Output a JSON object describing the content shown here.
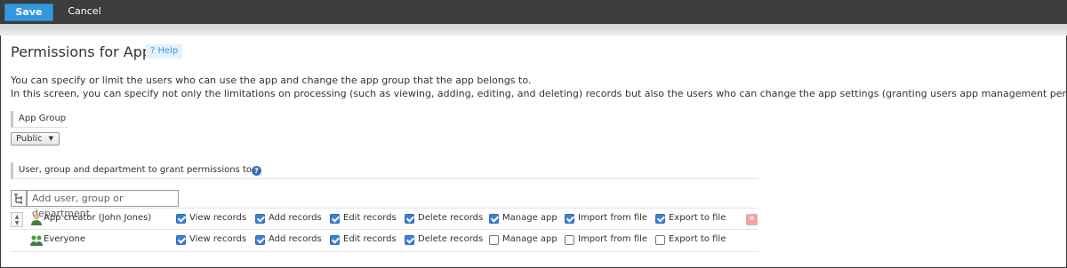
{
  "toolbar": {
    "save_label": "Save",
    "cancel_label": "Cancel"
  },
  "page": {
    "title": "Permissions for App",
    "help_label": "Help",
    "help_icon": "?",
    "description_line1": "You can specify or limit the users who can use the app and change the app group that the app belongs to.",
    "description_line2": "In this screen, you can specify not only the limitations on processing (such as viewing, adding, editing, and deleting) records but also the users who can change the app settings (granting users app management permissions)."
  },
  "app_group": {
    "label": "App Group",
    "selected": "Public"
  },
  "permissions_section": {
    "label": "User, group and department to grant permissions to",
    "add_placeholder": "Add user, group or department"
  },
  "permission_columns": [
    "View records",
    "Add records",
    "Edit records",
    "Delete records",
    "Manage app",
    "Import from file",
    "Export to file"
  ],
  "rows": [
    {
      "name": "App creator (John Jones)",
      "icon": "user-icon",
      "view": true,
      "add": true,
      "edit": true,
      "delete": true,
      "manage": true,
      "import": true,
      "export": true
    },
    {
      "name": "Everyone",
      "icon": "group-icon",
      "view": true,
      "add": true,
      "edit": true,
      "delete": true,
      "manage": false,
      "import": false,
      "export": false
    }
  ],
  "colors": {
    "accent": "#3498db",
    "toolbar": "#3a3c3e",
    "checkbox_checked": "#3b7fd6",
    "delete": "#e9a7a7"
  }
}
